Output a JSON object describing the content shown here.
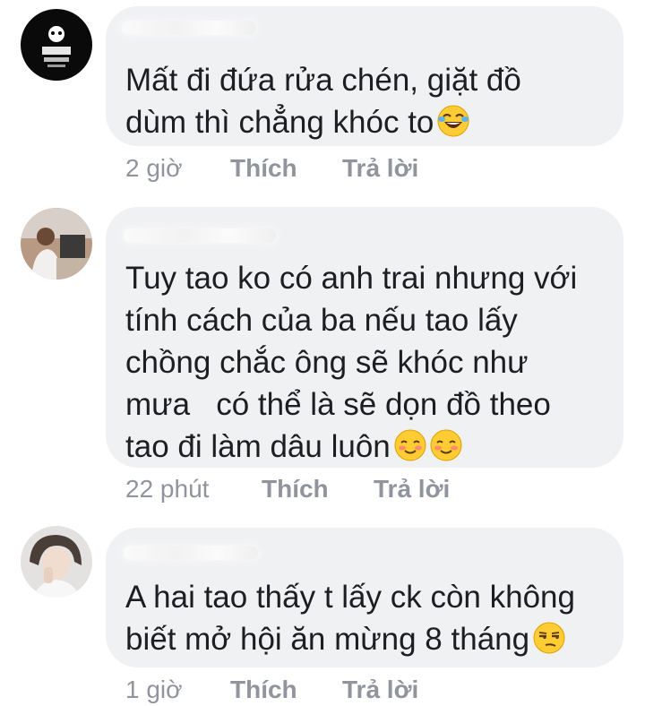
{
  "comments": [
    {
      "body_lines": [
        "Mất đi đứa rửa chén, giặt đồ",
        "dùm thì chẳng khóc to"
      ],
      "trailing_emoji": [
        "laughing-tears-emoji"
      ],
      "time": "2 giờ",
      "like_label": "Thích",
      "reply_label": "Trả lời"
    },
    {
      "body_lines": [
        "Tuy tao ko có anh trai nhưng với",
        "tính cách của ba nếu tao lấy",
        "chồng chắc ông sẽ khóc như",
        "mưa   có thể là sẽ dọn đồ theo",
        "tao đi làm dâu luôn"
      ],
      "trailing_emoji": [
        "smiling-blush-emoji",
        "smiling-blush-emoji"
      ],
      "time": "22 phút",
      "like_label": "Thích",
      "reply_label": "Trả lời"
    },
    {
      "body_lines": [
        "A hai tao thấy t lấy ck còn không",
        "biết mở hội ăn mừng 8 tháng"
      ],
      "trailing_emoji": [
        "unamused-emoji"
      ],
      "time": "1 giờ",
      "like_label": "Thích",
      "reply_label": "Trả lời"
    }
  ],
  "colors": {
    "bubble": "#eff1f3",
    "text": "#1c1e21",
    "meta": "#90949c"
  }
}
